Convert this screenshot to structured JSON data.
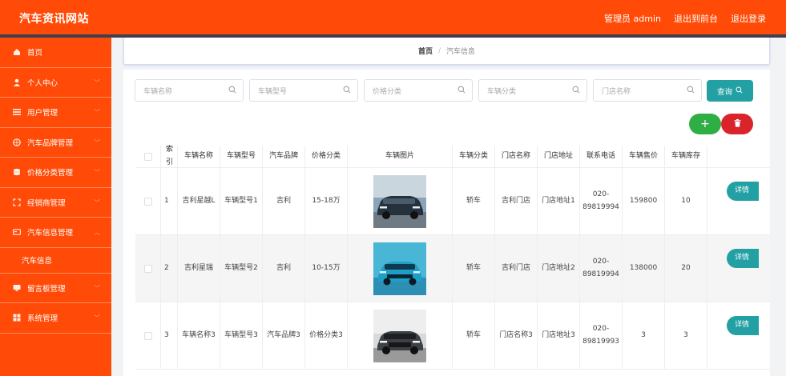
{
  "app": {
    "title": "汽车资讯网站"
  },
  "topbar": {
    "user": "管理员 admin",
    "front": "退出到前台",
    "logout": "退出登录"
  },
  "sidebar": {
    "items": [
      {
        "label": "首页",
        "icon": "home-icon"
      },
      {
        "label": "个人中心",
        "icon": "user-icon"
      },
      {
        "label": "用户管理",
        "icon": "list-icon"
      },
      {
        "label": "汽车品牌管理",
        "icon": "globe-icon"
      },
      {
        "label": "价格分类管理",
        "icon": "stack-icon"
      },
      {
        "label": "经销商管理",
        "icon": "expand-icon"
      },
      {
        "label": "汽车信息管理",
        "icon": "card-icon"
      }
    ],
    "sub": "汽车信息",
    "items_after": [
      {
        "label": "留言板管理",
        "icon": "monitor-icon"
      },
      {
        "label": "系统管理",
        "icon": "grid-icon"
      }
    ]
  },
  "breadcrumb": {
    "home": "首页",
    "sep": "/",
    "current": "汽车信息"
  },
  "search": {
    "placeholders": [
      "车辆名称",
      "车辆型号",
      "价格分类",
      "车辆分类",
      "门店名称"
    ],
    "query_label": "查询"
  },
  "table": {
    "headers": [
      "索引",
      "车辆名称",
      "车辆型号",
      "汽车品牌",
      "价格分类",
      "车辆图片",
      "车辆分类",
      "门店名称",
      "门店地址",
      "联系电话",
      "车辆售价",
      "车辆库存"
    ],
    "rows": [
      {
        "index": "1",
        "name": "吉利星越L",
        "model": "车辆型号1",
        "brand": "吉利",
        "price_cat": "15-18万",
        "category": "轿车",
        "store": "吉利门店",
        "address": "门店地址1",
        "phone": "020-89819994",
        "price": "159800",
        "stock": "10",
        "detail": "详情"
      },
      {
        "index": "2",
        "name": "吉利星瑞",
        "model": "车辆型号2",
        "brand": "吉利",
        "price_cat": "10-15万",
        "category": "轿车",
        "store": "吉利门店",
        "address": "门店地址2",
        "phone": "020-89819994",
        "price": "138000",
        "stock": "20",
        "detail": "详情"
      },
      {
        "index": "3",
        "name": "车辆名称3",
        "model": "车辆型号3",
        "brand": "汽车品牌3",
        "price_cat": "价格分类3",
        "category": "轿车",
        "store": "门店名称3",
        "address": "门店地址3",
        "phone": "020-89819993",
        "price": "3",
        "stock": "3",
        "detail": "详情"
      }
    ]
  },
  "colors": {
    "primary": "#ff4b07",
    "teal": "#22a0a4",
    "green": "#2fae43",
    "red": "#d9242b",
    "dark": "#3e3f51"
  }
}
